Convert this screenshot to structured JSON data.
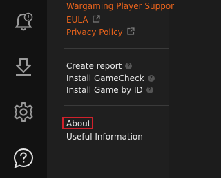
{
  "sidebar": {
    "icons": [
      {
        "name": "notifications-bell-icon"
      },
      {
        "name": "download-icon"
      },
      {
        "name": "settings-gear-icon"
      },
      {
        "name": "help-chat-icon"
      }
    ]
  },
  "links": {
    "support_label": "Wargaming Player Suppor",
    "eula_label": "EULA",
    "privacy_label": "Privacy Policy"
  },
  "menu": {
    "create_report": "Create report",
    "install_gamecheck": "Install GameCheck",
    "install_game_by_id": "Install Game by ID",
    "about": "About",
    "useful_information": "Useful Information",
    "help_symbol": "?"
  },
  "colors": {
    "accent": "#e8631c",
    "highlight_box": "#d0212b",
    "sidebar_bg": "#121212",
    "panel_bg": "#1f1f1f"
  }
}
